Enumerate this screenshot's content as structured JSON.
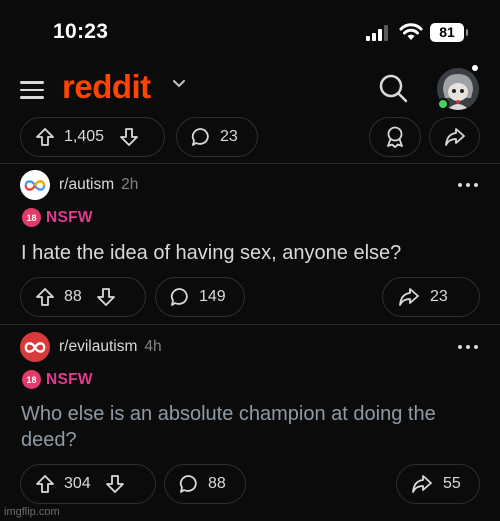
{
  "status_bar": {
    "time": "10:23",
    "battery": "81"
  },
  "header": {
    "logo": "reddit"
  },
  "prev_post": {
    "upvotes": "1,405",
    "comments": "23"
  },
  "posts": [
    {
      "subreddit": "r/autism",
      "time": "2h",
      "nsfw_label": "NSFW",
      "nsfw_badge": "18",
      "title": "I hate the idea of having sex, anyone else?",
      "upvotes": "88",
      "comments": "149",
      "shares": "23",
      "icon_color": "#ffffff"
    },
    {
      "subreddit": "r/evilautism",
      "time": "4h",
      "nsfw_label": "NSFW",
      "nsfw_badge": "18",
      "title": "Who else is an absolute champion at doing the deed?",
      "upvotes": "304",
      "comments": "88",
      "shares": "55",
      "icon_color": "#d93a3a"
    }
  ],
  "watermark": "imgflip.com",
  "colors": {
    "brand": "#ff4500",
    "nsfw": "#e23a8f",
    "background": "#0b0b0c"
  }
}
